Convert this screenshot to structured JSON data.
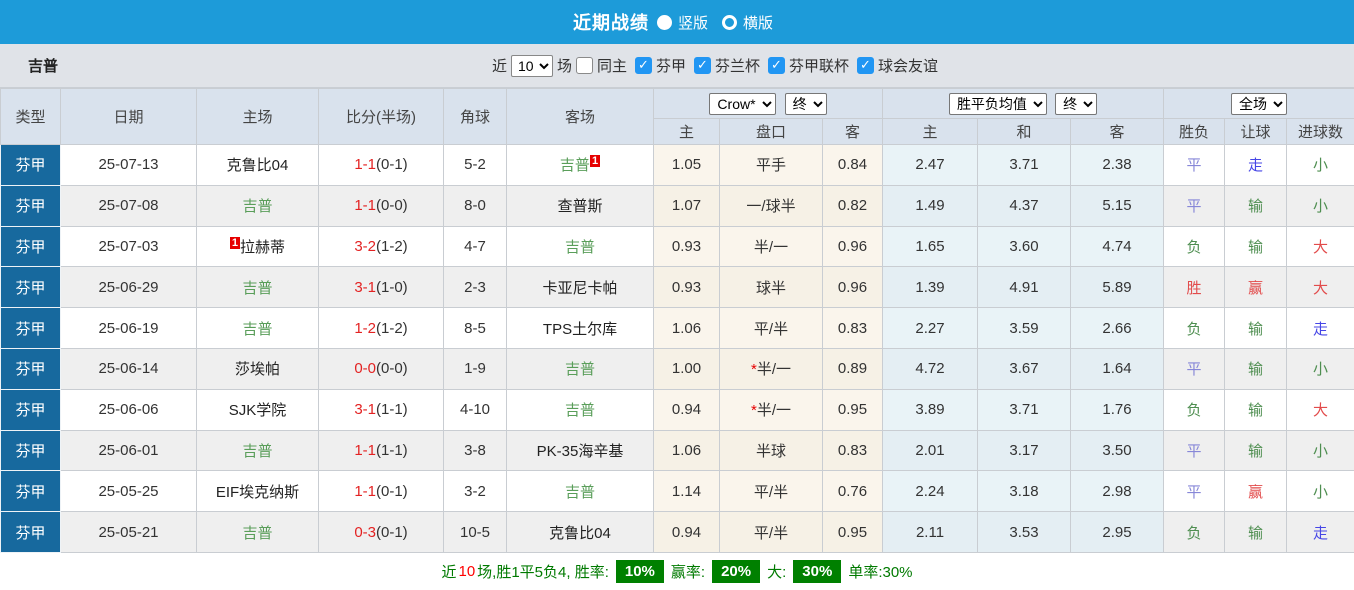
{
  "colors": {
    "topbar_blue": "#1d9bd9",
    "league_cell_bg": "#17699e",
    "team_green": "#5a9e5a",
    "score_red": "#e32222",
    "badge_red": "#e60000",
    "result_red": "#e24b4b",
    "result_green": "#4e8e50",
    "result_blue": "#8787d8",
    "result_blue_strong": "#4646e6",
    "summary_green": "#008000",
    "checkbox_blue": "#2196f3",
    "cream_bg": "#faf5ec",
    "avg_bg": "#e9f3f7"
  },
  "topbar": {
    "title": "近期战绩",
    "radios": [
      {
        "label": "竖版",
        "selected": true
      },
      {
        "label": "横版",
        "selected": false
      }
    ]
  },
  "filter": {
    "team": "吉普",
    "near_label": "近",
    "near_value": "10",
    "games_label": "场",
    "checkboxes": [
      {
        "label": "同主",
        "checked": false
      },
      {
        "label": "芬甲",
        "checked": true
      },
      {
        "label": "芬兰杯",
        "checked": true
      },
      {
        "label": "芬甲联杯",
        "checked": true
      },
      {
        "label": "球会友谊",
        "checked": true
      }
    ]
  },
  "header": {
    "cols": [
      "类型",
      "日期",
      "主场",
      "比分(半场)",
      "角球",
      "客场"
    ],
    "crow_select": "Crow*",
    "crow_final_select": "终",
    "crow_subcols": [
      "主",
      "盘口",
      "客"
    ],
    "avg_select": "胜平负均值",
    "avg_final_select": "终",
    "avg_subcols": [
      "主",
      "和",
      "客"
    ],
    "scope_select": "全场",
    "result_subcols": [
      "胜负",
      "让球",
      "进球数"
    ]
  },
  "rows": [
    {
      "league": "芬甲",
      "date": "25-07-13",
      "home": "克鲁比04",
      "home_badge": "",
      "home_color": "black",
      "score_ft": "1-1",
      "score_ht": "(0-1)",
      "corner": "5-2",
      "away": "吉普",
      "away_badge": "1",
      "away_color": "green",
      "crow_home": "1.05",
      "handicap_star": "",
      "handicap": "平手",
      "crow_away": "0.84",
      "avg_home": "2.47",
      "avg_draw": "3.71",
      "avg_away": "2.38",
      "result_wdl": "平",
      "result_wdl_color": "blue",
      "result_handicap": "走",
      "result_handicap_color": "blue2",
      "result_goals": "小",
      "result_goals_color": "green"
    },
    {
      "league": "芬甲",
      "date": "25-07-08",
      "home": "吉普",
      "home_badge": "",
      "home_color": "green",
      "score_ft": "1-1",
      "score_ht": "(0-0)",
      "corner": "8-0",
      "away": "查普斯",
      "away_badge": "",
      "away_color": "black",
      "crow_home": "1.07",
      "handicap_star": "",
      "handicap": "一/球半",
      "crow_away": "0.82",
      "avg_home": "1.49",
      "avg_draw": "4.37",
      "avg_away": "5.15",
      "result_wdl": "平",
      "result_wdl_color": "blue",
      "result_handicap": "输",
      "result_handicap_color": "green",
      "result_goals": "小",
      "result_goals_color": "green"
    },
    {
      "league": "芬甲",
      "date": "25-07-03",
      "home": "拉赫蒂",
      "home_badge": "1",
      "home_color": "black",
      "score_ft": "3-2",
      "score_ht": "(1-2)",
      "corner": "4-7",
      "away": "吉普",
      "away_badge": "",
      "away_color": "green",
      "crow_home": "0.93",
      "handicap_star": "",
      "handicap": "半/一",
      "crow_away": "0.96",
      "avg_home": "1.65",
      "avg_draw": "3.60",
      "avg_away": "4.74",
      "result_wdl": "负",
      "result_wdl_color": "green",
      "result_handicap": "输",
      "result_handicap_color": "green",
      "result_goals": "大",
      "result_goals_color": "red"
    },
    {
      "league": "芬甲",
      "date": "25-06-29",
      "home": "吉普",
      "home_badge": "",
      "home_color": "green",
      "score_ft": "3-1",
      "score_ht": "(1-0)",
      "corner": "2-3",
      "away": "卡亚尼卡帕",
      "away_badge": "",
      "away_color": "black",
      "crow_home": "0.93",
      "handicap_star": "",
      "handicap": "球半",
      "crow_away": "0.96",
      "avg_home": "1.39",
      "avg_draw": "4.91",
      "avg_away": "5.89",
      "result_wdl": "胜",
      "result_wdl_color": "red",
      "result_handicap": "赢",
      "result_handicap_color": "red",
      "result_goals": "大",
      "result_goals_color": "red"
    },
    {
      "league": "芬甲",
      "date": "25-06-19",
      "home": "吉普",
      "home_badge": "",
      "home_color": "green",
      "score_ft": "1-2",
      "score_ht": "(1-2)",
      "corner": "8-5",
      "away": "TPS土尔库",
      "away_badge": "",
      "away_color": "black",
      "crow_home": "1.06",
      "handicap_star": "",
      "handicap": "平/半",
      "crow_away": "0.83",
      "avg_home": "2.27",
      "avg_draw": "3.59",
      "avg_away": "2.66",
      "result_wdl": "负",
      "result_wdl_color": "green",
      "result_handicap": "输",
      "result_handicap_color": "green",
      "result_goals": "走",
      "result_goals_color": "blue2"
    },
    {
      "league": "芬甲",
      "date": "25-06-14",
      "home": "莎埃帕",
      "home_badge": "",
      "home_color": "black",
      "score_ft": "0-0",
      "score_ht": "(0-0)",
      "corner": "1-9",
      "away": "吉普",
      "away_badge": "",
      "away_color": "green",
      "crow_home": "1.00",
      "handicap_star": "*",
      "handicap": "半/一",
      "crow_away": "0.89",
      "avg_home": "4.72",
      "avg_draw": "3.67",
      "avg_away": "1.64",
      "result_wdl": "平",
      "result_wdl_color": "blue",
      "result_handicap": "输",
      "result_handicap_color": "green",
      "result_goals": "小",
      "result_goals_color": "green"
    },
    {
      "league": "芬甲",
      "date": "25-06-06",
      "home": "SJK学院",
      "home_badge": "",
      "home_color": "black",
      "score_ft": "3-1",
      "score_ht": "(1-1)",
      "corner": "4-10",
      "away": "吉普",
      "away_badge": "",
      "away_color": "green",
      "crow_home": "0.94",
      "handicap_star": "*",
      "handicap": "半/一",
      "crow_away": "0.95",
      "avg_home": "3.89",
      "avg_draw": "3.71",
      "avg_away": "1.76",
      "result_wdl": "负",
      "result_wdl_color": "green",
      "result_handicap": "输",
      "result_handicap_color": "green",
      "result_goals": "大",
      "result_goals_color": "red"
    },
    {
      "league": "芬甲",
      "date": "25-06-01",
      "home": "吉普",
      "home_badge": "",
      "home_color": "green",
      "score_ft": "1-1",
      "score_ht": "(1-1)",
      "corner": "3-8",
      "away": "PK-35海辛基",
      "away_badge": "",
      "away_color": "black",
      "crow_home": "1.06",
      "handicap_star": "",
      "handicap": "半球",
      "crow_away": "0.83",
      "avg_home": "2.01",
      "avg_draw": "3.17",
      "avg_away": "3.50",
      "result_wdl": "平",
      "result_wdl_color": "blue",
      "result_handicap": "输",
      "result_handicap_color": "green",
      "result_goals": "小",
      "result_goals_color": "green"
    },
    {
      "league": "芬甲",
      "date": "25-05-25",
      "home": "EIF埃克纳斯",
      "home_badge": "",
      "home_color": "black",
      "score_ft": "1-1",
      "score_ht": "(0-1)",
      "corner": "3-2",
      "away": "吉普",
      "away_badge": "",
      "away_color": "green",
      "crow_home": "1.14",
      "handicap_star": "",
      "handicap": "平/半",
      "crow_away": "0.76",
      "avg_home": "2.24",
      "avg_draw": "3.18",
      "avg_away": "2.98",
      "result_wdl": "平",
      "result_wdl_color": "blue",
      "result_handicap": "赢",
      "result_handicap_color": "red",
      "result_goals": "小",
      "result_goals_color": "green"
    },
    {
      "league": "芬甲",
      "date": "25-05-21",
      "home": "吉普",
      "home_badge": "",
      "home_color": "green",
      "score_ft": "0-3",
      "score_ht": "(0-1)",
      "corner": "10-5",
      "away": "克鲁比04",
      "away_badge": "",
      "away_color": "black",
      "crow_home": "0.94",
      "handicap_star": "",
      "handicap": "平/半",
      "crow_away": "0.95",
      "avg_home": "2.11",
      "avg_draw": "3.53",
      "avg_away": "2.95",
      "result_wdl": "负",
      "result_wdl_color": "green",
      "result_handicap": "输",
      "result_handicap_color": "green",
      "result_goals": "走",
      "result_goals_color": "blue2"
    }
  ],
  "summary": {
    "near_label": "近",
    "count": "10",
    "middle": "场,胜1平5负4, 胜率:",
    "rate1": "10%",
    "label2": "赢率:",
    "rate2": "20%",
    "label3": "大:",
    "rate3": "30%",
    "tail": "单率:30%"
  }
}
